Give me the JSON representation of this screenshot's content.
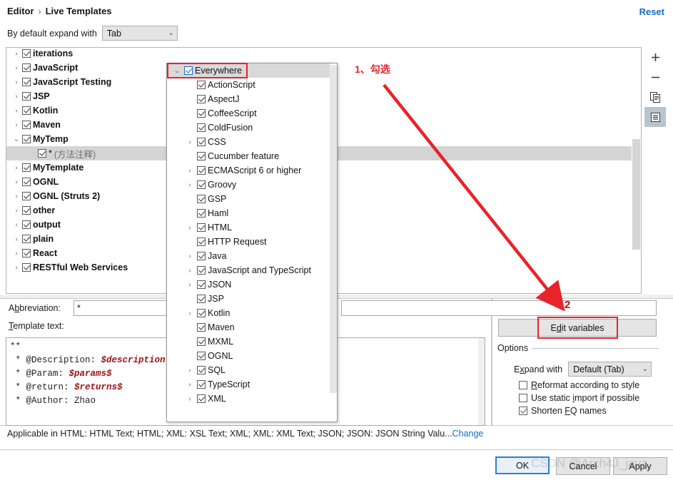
{
  "header": {
    "breadcrumb_root": "Editor",
    "breadcrumb_sep": "›",
    "breadcrumb_current": "Live Templates",
    "reset_label": "Reset"
  },
  "expand": {
    "label": "By default expand with",
    "value": "Tab",
    "chevron": "⌄"
  },
  "tree": {
    "items": [
      {
        "arrow": "›",
        "label": "iterations",
        "checked": true,
        "selected": false,
        "child": false
      },
      {
        "arrow": "›",
        "label": "JavaScript",
        "checked": true,
        "selected": false,
        "child": false
      },
      {
        "arrow": "›",
        "label": "JavaScript Testing",
        "checked": true,
        "selected": false,
        "child": false
      },
      {
        "arrow": "›",
        "label": "JSP",
        "checked": true,
        "selected": false,
        "child": false
      },
      {
        "arrow": "›",
        "label": "Kotlin",
        "checked": true,
        "selected": false,
        "child": false
      },
      {
        "arrow": "›",
        "label": "Maven",
        "checked": true,
        "selected": false,
        "child": false
      },
      {
        "arrow": "⌄",
        "label": "MyTemp",
        "checked": true,
        "selected": false,
        "child": false
      },
      {
        "arrow": "",
        "label": "*",
        "suffix": "(方法注释)",
        "checked": true,
        "selected": true,
        "child": true
      },
      {
        "arrow": "›",
        "label": "MyTemplate",
        "checked": true,
        "selected": false,
        "child": false
      },
      {
        "arrow": "›",
        "label": "OGNL",
        "checked": true,
        "selected": false,
        "child": false
      },
      {
        "arrow": "›",
        "label": "OGNL (Struts 2)",
        "checked": true,
        "selected": false,
        "child": false
      },
      {
        "arrow": "›",
        "label": "other",
        "checked": true,
        "selected": false,
        "child": false
      },
      {
        "arrow": "›",
        "label": "output",
        "checked": true,
        "selected": false,
        "child": false
      },
      {
        "arrow": "›",
        "label": "plain",
        "checked": true,
        "selected": false,
        "child": false
      },
      {
        "arrow": "›",
        "label": "React",
        "checked": true,
        "selected": false,
        "child": false
      },
      {
        "arrow": "›",
        "label": "RESTful Web Services",
        "checked": true,
        "selected": false,
        "child": false
      }
    ]
  },
  "toolbar": {
    "add_icon": "plus-icon",
    "remove_icon": "minus-icon",
    "duplicate_icon": "copy-icon",
    "change_context_icon": "list-icon"
  },
  "context_popup": {
    "items": [
      {
        "arrow": "⌄",
        "label": "Everywhere",
        "checked": true,
        "header": true,
        "indent": 0
      },
      {
        "arrow": "",
        "label": "ActionScript",
        "checked": true,
        "indent": 1
      },
      {
        "arrow": "",
        "label": "AspectJ",
        "checked": true,
        "indent": 1
      },
      {
        "arrow": "",
        "label": "CoffeeScript",
        "checked": true,
        "indent": 1
      },
      {
        "arrow": "",
        "label": "ColdFusion",
        "checked": true,
        "indent": 1
      },
      {
        "arrow": "›",
        "label": "CSS",
        "checked": true,
        "indent": 1
      },
      {
        "arrow": "",
        "label": "Cucumber feature",
        "checked": true,
        "indent": 1
      },
      {
        "arrow": "›",
        "label": "ECMAScript 6 or higher",
        "checked": true,
        "indent": 1
      },
      {
        "arrow": "›",
        "label": "Groovy",
        "checked": true,
        "indent": 1
      },
      {
        "arrow": "",
        "label": "GSP",
        "checked": true,
        "indent": 1
      },
      {
        "arrow": "",
        "label": "Haml",
        "checked": true,
        "indent": 1
      },
      {
        "arrow": "›",
        "label": "HTML",
        "checked": true,
        "indent": 1
      },
      {
        "arrow": "",
        "label": "HTTP Request",
        "checked": true,
        "indent": 1
      },
      {
        "arrow": "›",
        "label": "Java",
        "checked": true,
        "indent": 1
      },
      {
        "arrow": "›",
        "label": "JavaScript and TypeScript",
        "checked": true,
        "indent": 1
      },
      {
        "arrow": "›",
        "label": "JSON",
        "checked": true,
        "indent": 1
      },
      {
        "arrow": "",
        "label": "JSP",
        "checked": true,
        "indent": 1
      },
      {
        "arrow": "›",
        "label": "Kotlin",
        "checked": true,
        "indent": 1
      },
      {
        "arrow": "",
        "label": "Maven",
        "checked": true,
        "indent": 1
      },
      {
        "arrow": "",
        "label": "MXML",
        "checked": true,
        "indent": 1
      },
      {
        "arrow": "",
        "label": "OGNL",
        "checked": true,
        "indent": 1
      },
      {
        "arrow": "›",
        "label": "SQL",
        "checked": true,
        "indent": 1
      },
      {
        "arrow": "›",
        "label": "TypeScript",
        "checked": true,
        "indent": 1
      },
      {
        "arrow": "›",
        "label": "XML",
        "checked": true,
        "indent": 1
      }
    ]
  },
  "fields": {
    "abbreviation_label_pre": "A",
    "abbreviation_label_u": "b",
    "abbreviation_label_post": "breviation:",
    "abbreviation_value": "*",
    "template_text_label_u": "T",
    "template_text_label_post": "emplate text:",
    "template_lines": [
      {
        "plain": "**",
        "var": ""
      },
      {
        "plain": " * @Description: ",
        "var": "$description"
      },
      {
        "plain": " * @Param: ",
        "var": "$params$"
      },
      {
        "plain": " * @return: ",
        "var": "$returns$"
      },
      {
        "plain": " * @Author: Zhao",
        "var": ""
      }
    ]
  },
  "applicable": {
    "text": "Applicable in HTML: HTML Text; HTML; XML: XSL Text; XML; XML: XML Text; JSON; JSON: JSON String Valu...",
    "change_label": "Change"
  },
  "right_panel": {
    "edit_variables_pre": "E",
    "edit_variables_u": "d",
    "edit_variables_post": "it variables",
    "options_legend": "Options",
    "expand_with_label_pre": "E",
    "expand_with_label_u": "x",
    "expand_with_label_post": "pand with",
    "expand_with_value": "Default (Tab)",
    "chevron": "⌄",
    "checkboxes": [
      {
        "pre": "",
        "u": "R",
        "post": "eformat according to style",
        "checked": false
      },
      {
        "pre": "Use static ",
        "u": "i",
        "post": "mport if possible",
        "checked": false
      },
      {
        "pre": "Shorten ",
        "u": "F",
        "post": "Q names",
        "checked": true
      }
    ]
  },
  "buttons": {
    "ok": "OK",
    "cancel": "Cancel",
    "apply": "Apply"
  },
  "annotations": {
    "step1": "1、勾选",
    "step2": "2",
    "arrow_color": "#e8232a"
  },
  "watermark": {
    "text": "CSDN @Arch4J_java"
  }
}
